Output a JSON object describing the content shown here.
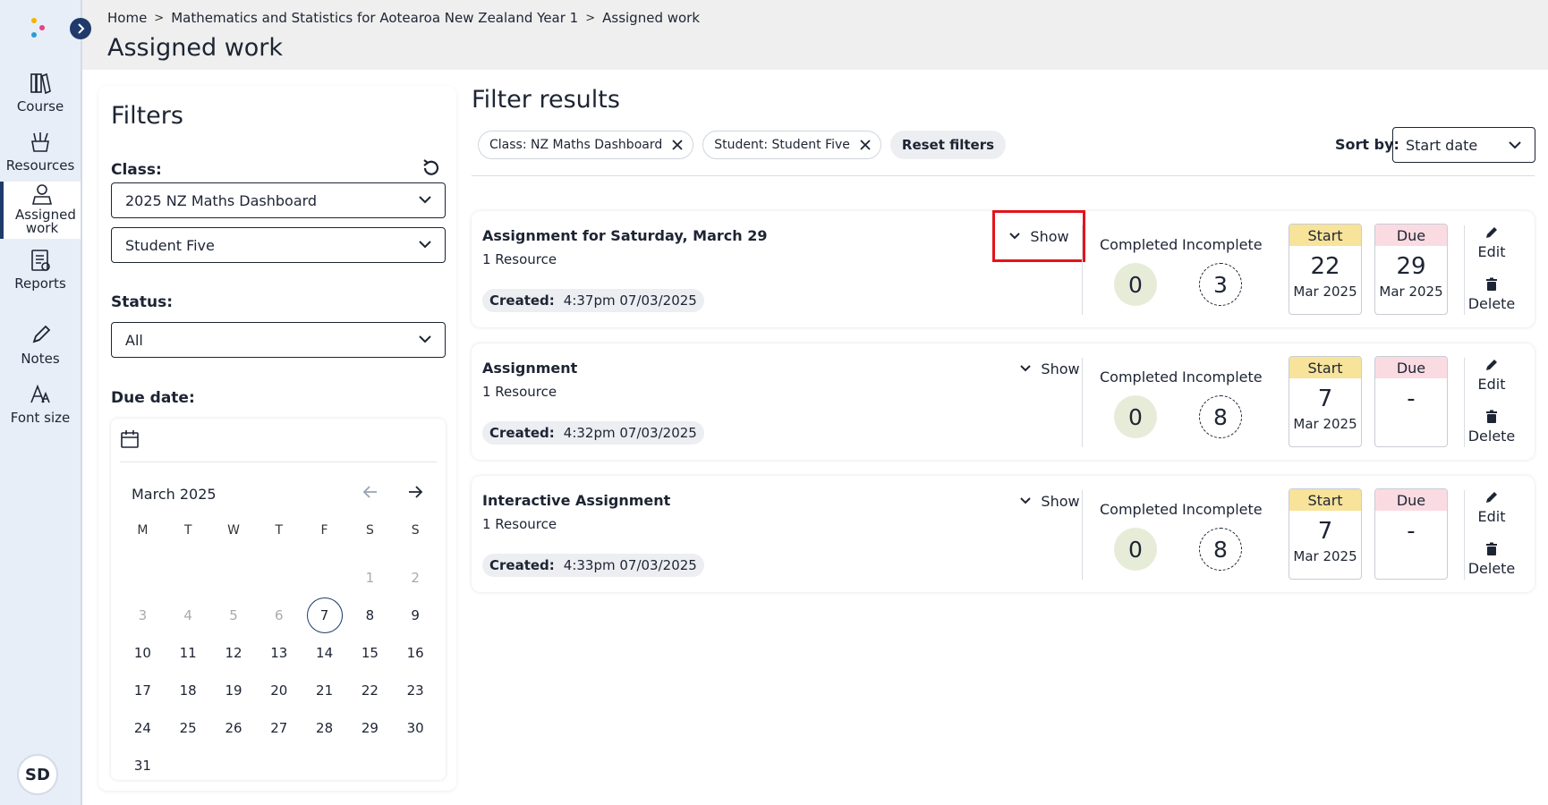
{
  "sidebar": {
    "items": [
      {
        "label": "Course",
        "icon": "books-icon"
      },
      {
        "label": "Resources",
        "icon": "resources-icon"
      },
      {
        "label": "Assigned work",
        "icon": "assigned-work-icon"
      },
      {
        "label": "Reports",
        "icon": "reports-icon"
      },
      {
        "label": "Notes",
        "icon": "pencil-icon"
      },
      {
        "label": "Font size",
        "icon": "font-size-icon"
      }
    ],
    "avatar": "SD"
  },
  "header": {
    "breadcrumb": [
      "Home",
      "Mathematics and Statistics for Aotearoa New Zealand Year 1",
      "Assigned work"
    ],
    "title": "Assigned work"
  },
  "filters": {
    "title": "Filters",
    "class_label": "Class:",
    "class_value": "2025 NZ Maths Dashboard",
    "student_value": "Student Five",
    "status_label": "Status:",
    "status_value": "All",
    "due_label": "Due date:",
    "calendar": {
      "month": "March 2025",
      "weekdays": [
        "M",
        "T",
        "W",
        "T",
        "F",
        "S",
        "S"
      ],
      "leading_blank": 5,
      "days": [
        "1",
        "2",
        "3",
        "4",
        "5",
        "6",
        "7",
        "8",
        "9",
        "10",
        "11",
        "12",
        "13",
        "14",
        "15",
        "16",
        "17",
        "18",
        "19",
        "20",
        "21",
        "22",
        "23",
        "24",
        "25",
        "26",
        "27",
        "28",
        "29",
        "30",
        "31"
      ],
      "muted_days": [
        "1",
        "2",
        "3",
        "4",
        "5",
        "6"
      ],
      "selected_day": "7"
    }
  },
  "results": {
    "title": "Filter results",
    "chips": [
      "Class: NZ Maths Dashboard",
      "Student: Student Five"
    ],
    "reset_label": "Reset filters",
    "sort_label": "Sort by:",
    "sort_value": "Start date",
    "cards": [
      {
        "title": "Assignment for Saturday, March 29",
        "resources": "1 Resource",
        "created_label": "Created:",
        "created_value": "4:37pm 07/03/2025",
        "show_label": "Show",
        "completed_label": "Completed",
        "completed": "0",
        "incomplete_label": "Incomplete",
        "incomplete": "3",
        "start_label": "Start",
        "start_day": "22",
        "start_month": "Mar 2025",
        "due_label": "Due",
        "due_day": "29",
        "due_month": "Mar 2025",
        "edit_label": "Edit",
        "delete_label": "Delete"
      },
      {
        "title": "Assignment",
        "resources": "1 Resource",
        "created_label": "Created:",
        "created_value": "4:32pm 07/03/2025",
        "show_label": "Show",
        "completed_label": "Completed",
        "completed": "0",
        "incomplete_label": "Incomplete",
        "incomplete": "8",
        "start_label": "Start",
        "start_day": "7",
        "start_month": "Mar 2025",
        "due_label": "Due",
        "due_day": "-",
        "due_month": "",
        "edit_label": "Edit",
        "delete_label": "Delete"
      },
      {
        "title": "Interactive Assignment",
        "resources": "1 Resource",
        "created_label": "Created:",
        "created_value": "4:33pm 07/03/2025",
        "show_label": "Show",
        "completed_label": "Completed",
        "completed": "0",
        "incomplete_label": "Incomplete",
        "incomplete": "8",
        "start_label": "Start",
        "start_day": "7",
        "start_month": "Mar 2025",
        "due_label": "Due",
        "due_day": "-",
        "due_month": "",
        "edit_label": "Edit",
        "delete_label": "Delete"
      }
    ]
  },
  "colors": {
    "primary": "#1f3a6b",
    "highlight": "#e3141b",
    "start_header": "#f7e39a",
    "due_header": "#fbdbe2",
    "completed_bg": "#e7ecd9"
  }
}
